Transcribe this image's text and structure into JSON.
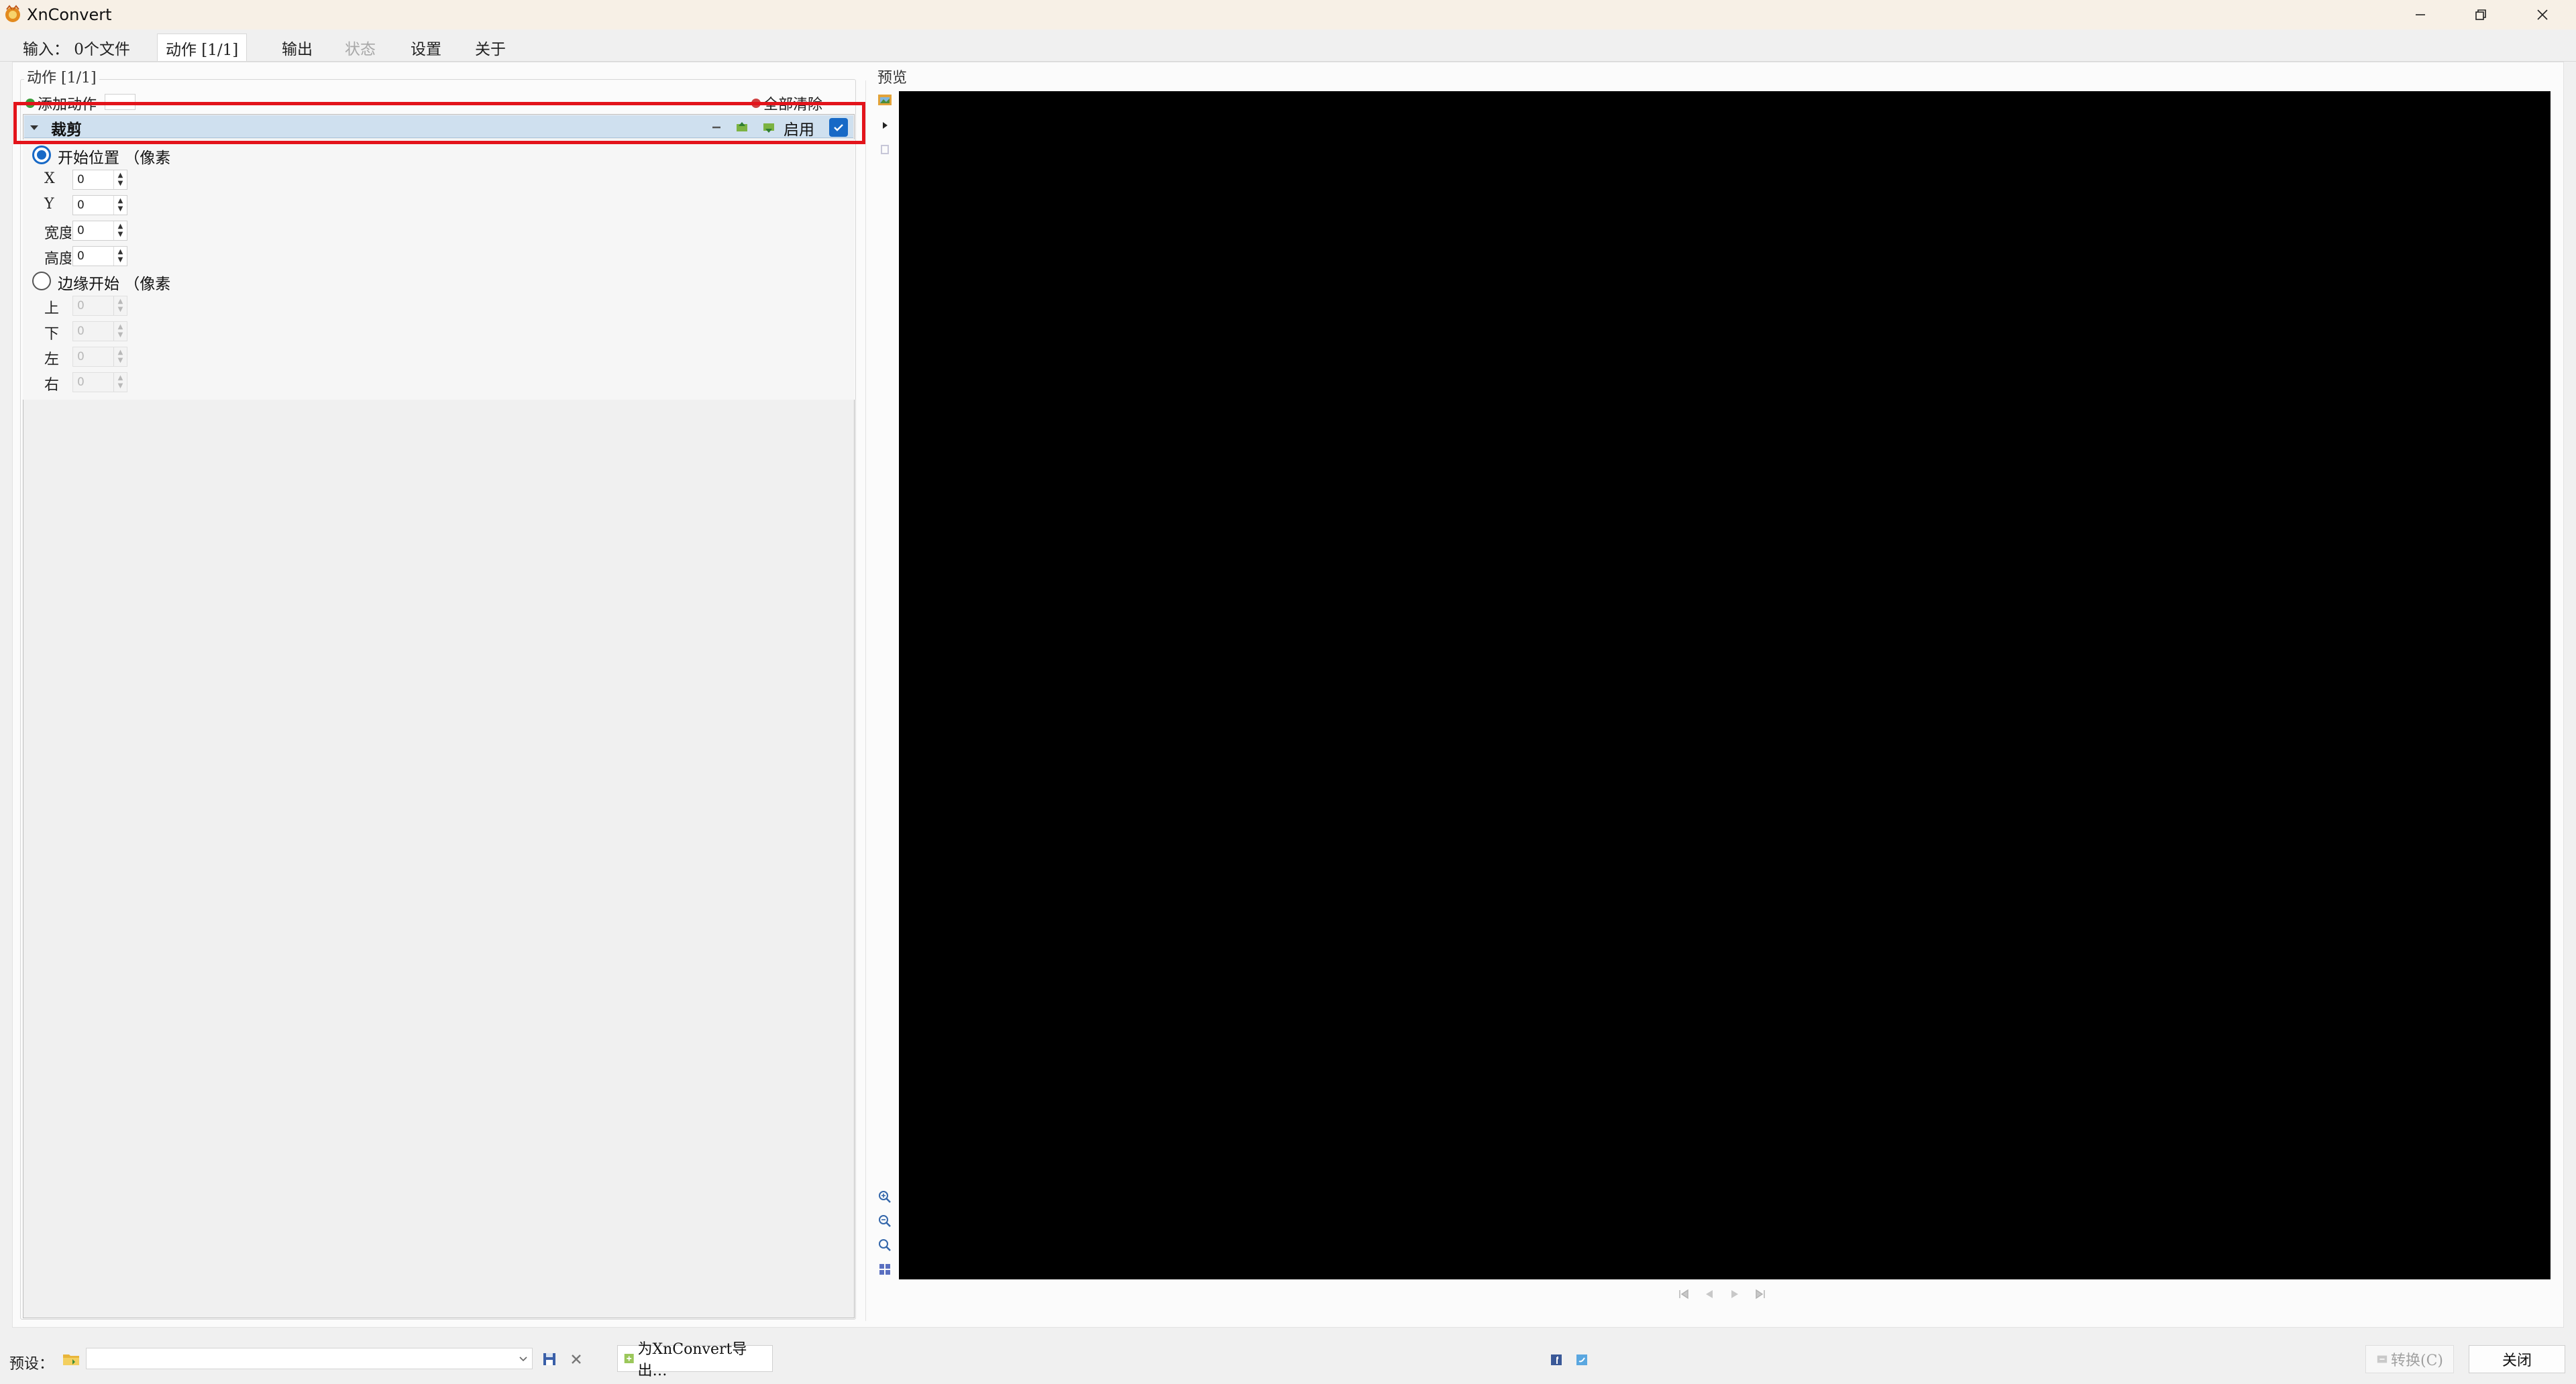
{
  "window": {
    "title": "XnConvert",
    "controls": [
      "minimize",
      "restore",
      "close"
    ]
  },
  "tabs": [
    {
      "label": "输入：  0个文件",
      "state": "normal"
    },
    {
      "label": "动作 [1/1]",
      "state": "active"
    },
    {
      "label": "输出",
      "state": "normal"
    },
    {
      "label": "状态",
      "state": "disabled"
    },
    {
      "label": "设置",
      "state": "normal"
    },
    {
      "label": "关于",
      "state": "normal"
    }
  ],
  "actions_panel": {
    "group_title": "动作 [1/1]",
    "add_action_label": "添加动作",
    "clear_all_label": "全部清除",
    "action": {
      "title": "裁剪",
      "enable_label": "启用",
      "enabled": true
    },
    "start_position": {
      "label": "开始位置  （像素",
      "selected": true,
      "fields": [
        {
          "label": "X",
          "value": "0"
        },
        {
          "label": "Y",
          "value": "0"
        },
        {
          "label": "宽度",
          "value": "0"
        },
        {
          "label": "高度",
          "value": "0"
        }
      ]
    },
    "edge_start": {
      "label": "边缘开始  （像素",
      "selected": false,
      "fields": [
        {
          "label": "上",
          "value": "0"
        },
        {
          "label": "下",
          "value": "0"
        },
        {
          "label": "左",
          "value": "0"
        },
        {
          "label": "右",
          "value": "0"
        }
      ]
    }
  },
  "preview": {
    "title": "预览"
  },
  "bottom_bar": {
    "preset_label": "预设：",
    "preset_value": "",
    "export_label": "为XnConvert导出…",
    "convert_label": "转换(C)",
    "close_label": "关闭"
  },
  "colors": {
    "accent": "#1769c6",
    "highlight": "#e3141b",
    "preview_background": "#000000"
  }
}
